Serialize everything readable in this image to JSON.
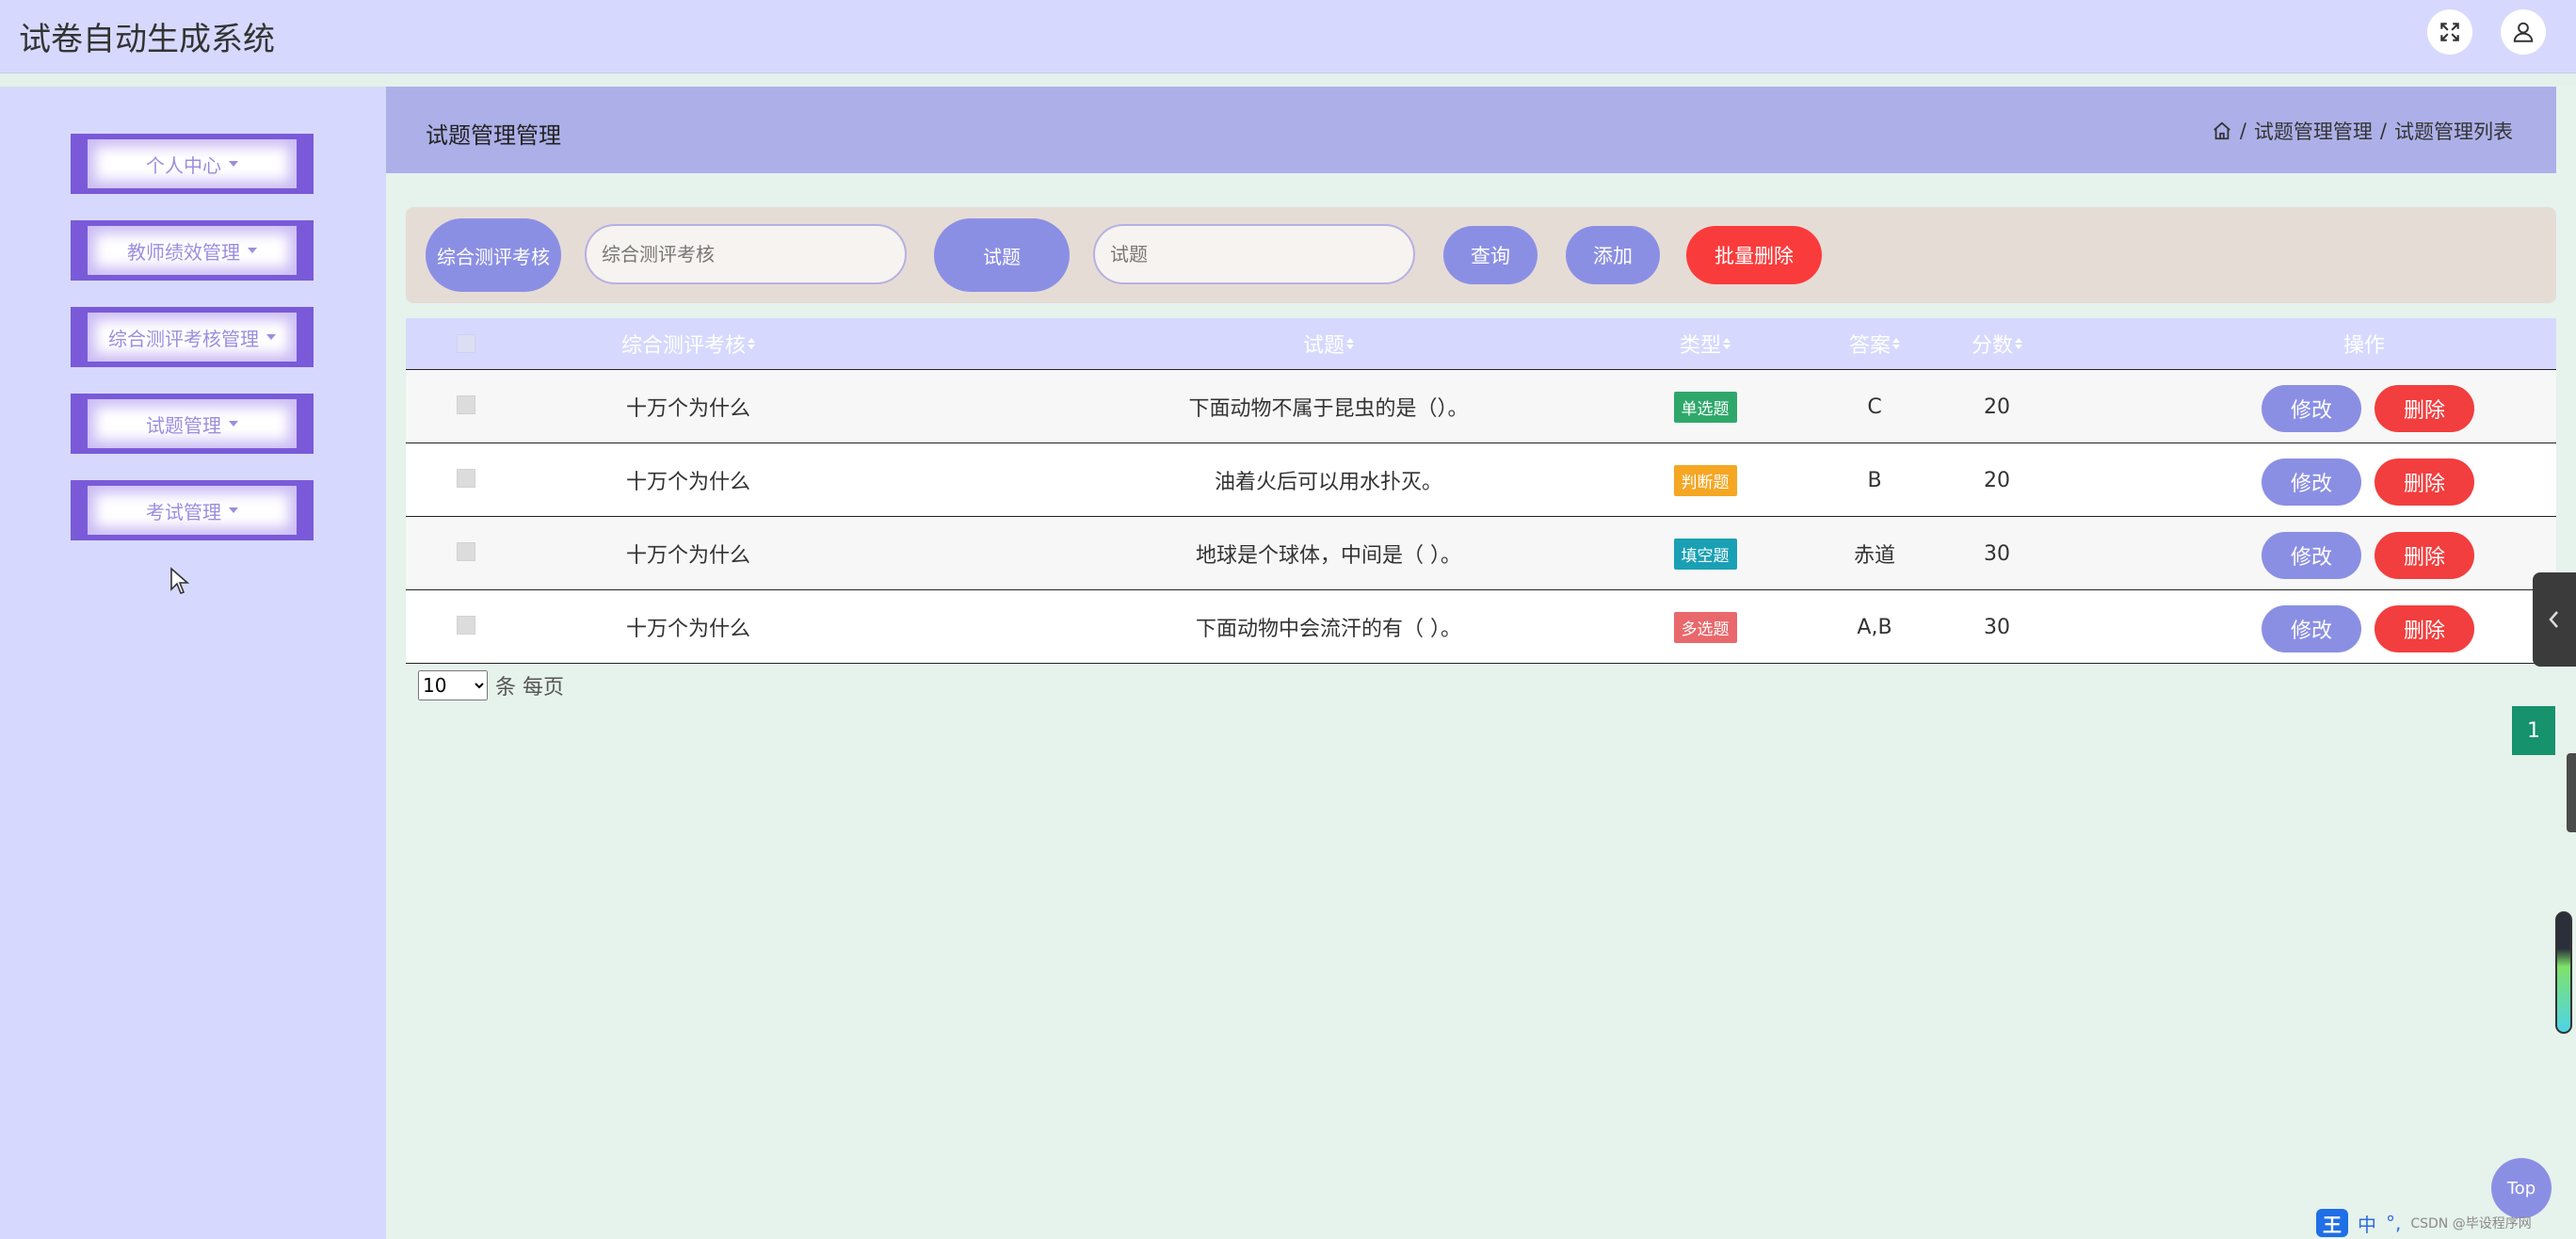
{
  "header": {
    "title": "试卷自动生成系统",
    "fullscreen_icon": "expand-icon",
    "user_icon": "user-icon"
  },
  "sidebar": {
    "items": [
      {
        "label": "个人中心"
      },
      {
        "label": "教师绩效管理"
      },
      {
        "label": "综合测评考核管理"
      },
      {
        "label": "试题管理"
      },
      {
        "label": "考试管理"
      }
    ]
  },
  "page": {
    "title": "试题管理管理",
    "breadcrumb": [
      "试题管理管理",
      "试题管理列表"
    ],
    "separator": "/"
  },
  "search": {
    "field1_label": "综合测评考核",
    "field1_placeholder": "综合测评考核",
    "field2_label": "试题",
    "field2_placeholder": "试题",
    "query_label": "查询",
    "add_label": "添加",
    "batch_delete_label": "批量删除"
  },
  "table": {
    "columns": [
      "综合测评考核",
      "试题",
      "类型",
      "答案",
      "分数",
      "操作"
    ],
    "rows": [
      {
        "exam": "十万个为什么",
        "question": "下面动物不属于昆虫的是（）。",
        "type": "单选题",
        "type_color": "#2ea86a",
        "answer": "C",
        "score": "20",
        "edit": "修改",
        "delete": "删除"
      },
      {
        "exam": "十万个为什么",
        "question": "油着火后可以用水扑灭。",
        "type": "判断题",
        "type_color": "#f5a623",
        "answer": "B",
        "score": "20",
        "edit": "修改",
        "delete": "删除"
      },
      {
        "exam": "十万个为什么",
        "question": "地球是个球体，中间是（ ）。",
        "type": "填空题",
        "type_color": "#1aa0b4",
        "answer": "赤道",
        "score": "30",
        "edit": "修改",
        "delete": "删除"
      },
      {
        "exam": "十万个为什么",
        "question": "下面动物中会流汗的有（ ）。",
        "type": "多选题",
        "type_color": "#e8686c",
        "answer": "A,B",
        "score": "30",
        "edit": "修改",
        "delete": "删除"
      }
    ]
  },
  "pagination": {
    "page_size": "10",
    "page_size_suffix": "条 每页",
    "current_page": "1"
  },
  "widgets": {
    "top_label": "Top",
    "ime": {
      "logo": "王",
      "mode": "中",
      "punct": "°,",
      "watermark": "CSDN @毕设程序网"
    }
  }
}
